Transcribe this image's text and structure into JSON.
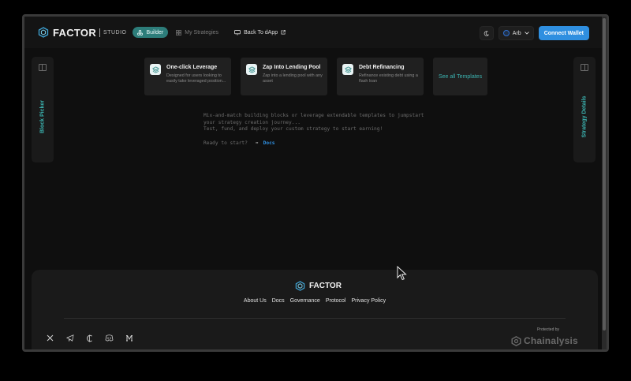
{
  "header": {
    "brand_name": "FACTOR",
    "brand_sub": "STUDIO",
    "nav": [
      {
        "label": "Builder",
        "icon": "builder-icon",
        "state": "active"
      },
      {
        "label": "My Strategies",
        "icon": "grid-icon",
        "state": "muted"
      },
      {
        "label": "Back To dApp",
        "icon": "monitor-icon",
        "state": "normal"
      }
    ],
    "network": "Arb",
    "connect_label": "Connect Wallet",
    "theme_icon": "moon-icon"
  },
  "sidebar_left": {
    "label": "Block Picker",
    "icon": "panel-left-icon"
  },
  "sidebar_right": {
    "label": "Strategy Details",
    "icon": "panel-right-icon"
  },
  "templates": [
    {
      "title": "One-click Leverage",
      "desc": "Designed for users looking to easily take leveraged position..."
    },
    {
      "title": "Zap Into Lending Pool",
      "desc": "Zap into a lending pool with any asset"
    },
    {
      "title": "Debt Refinancing",
      "desc": "Refinance existing debt using a flash loan"
    }
  ],
  "see_all_label": "See all Templates",
  "intro": {
    "line1": "Mix-and-match building blocks or leverage extendable templates to jumpstart",
    "line2": "your strategy creation journey...",
    "line3": "Test, fund, and deploy your custom strategy to start earning!",
    "ready": "Ready to start?",
    "arrow": "➡",
    "docs": "Docs"
  },
  "footer": {
    "brand_name": "FACTOR",
    "links": [
      "About Us",
      "Docs",
      "Governance",
      "Protocol",
      "Privacy Policy"
    ],
    "socials": [
      "x-icon",
      "telegram-icon",
      "coingecko-icon",
      "discord-icon",
      "medium-icon"
    ],
    "protected_by": "Protected by",
    "chainalysis": "Chainalysis"
  },
  "colors": {
    "accent_teal": "#3bb3b0",
    "builder_bg": "#2d7d7a",
    "connect_blue": "#2f8fe0",
    "background": "#0f0f0f"
  }
}
